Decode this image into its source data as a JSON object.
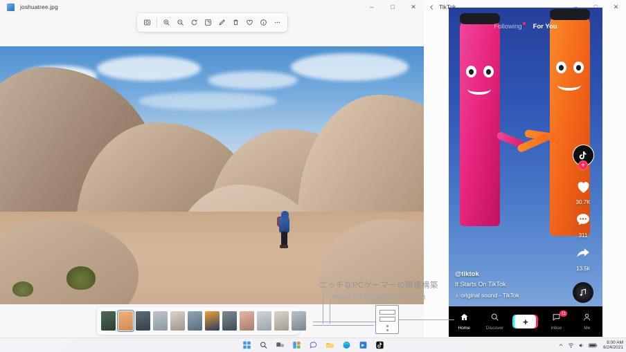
{
  "photos_window": {
    "title": "joshuatree.jpg",
    "icon": "photo-file-icon",
    "controls": {
      "minimize": "–",
      "maximize": "□",
      "close": "✕"
    },
    "toolbar": [
      {
        "name": "fit-to-window-icon",
        "label": "Fit to window"
      },
      {
        "name": "zoom-in-icon",
        "label": "Zoom in"
      },
      {
        "name": "zoom-out-icon",
        "label": "Zoom out"
      },
      {
        "name": "rotate-icon",
        "label": "Rotate"
      },
      {
        "name": "crop-icon",
        "label": "Crop"
      },
      {
        "name": "edit-pen-icon",
        "label": "Edit"
      },
      {
        "name": "delete-icon",
        "label": "Delete"
      },
      {
        "name": "favorite-heart-icon",
        "label": "Add to favorites"
      },
      {
        "name": "info-icon",
        "label": "File info"
      },
      {
        "name": "more-options-icon",
        "label": "See more"
      }
    ],
    "filmstrip": {
      "selected_index": 1,
      "thumbnails": [
        {
          "colors": [
            "#4e6b58",
            "#2e3d33"
          ]
        },
        {
          "colors": [
            "#f0b27a",
            "#d08a55"
          ]
        },
        {
          "colors": [
            "#5d6d79",
            "#333f49"
          ]
        },
        {
          "colors": [
            "#bfc6cd",
            "#8e979f"
          ]
        },
        {
          "colors": [
            "#d9d4cb",
            "#9b958b"
          ]
        },
        {
          "colors": [
            "#8fa4b2",
            "#5a6d7c"
          ]
        },
        {
          "colors": [
            "#f0a232",
            "#243a63"
          ]
        },
        {
          "colors": [
            "#7e8b95",
            "#3f4a54"
          ]
        },
        {
          "colors": [
            "#e3b5a6",
            "#a97b6d"
          ]
        },
        {
          "colors": [
            "#cfd6dc",
            "#9aa3ab"
          ]
        },
        {
          "colors": [
            "#dad4c9",
            "#a39c90"
          ]
        },
        {
          "colors": [
            "#b9c3cb",
            "#79848d"
          ]
        }
      ]
    }
  },
  "watermark": {
    "japanese": "ニッチなPCゲーマーの環境構築",
    "url": "www.nichepcgamer.com"
  },
  "tiktok_window": {
    "title": "TikTok",
    "back_icon": "back-arrow-icon",
    "controls": {
      "minimize": "–",
      "maximize": "□",
      "close": "✕"
    },
    "top_nav": {
      "following": "Following",
      "for_you": "For You",
      "active": "For You"
    },
    "actions": {
      "avatar_plus": "+",
      "like_count": "30.7K",
      "comment_count": "311",
      "share_count": "13.5k"
    },
    "caption": {
      "username": "@tiktok",
      "description": "It Starts On TikTok",
      "sound": "original sound - TikTok",
      "music_glyph": "♪"
    },
    "bottom_nav": [
      {
        "name": "home",
        "label": "Home",
        "icon": "home-icon",
        "active": true,
        "badge": ""
      },
      {
        "name": "discover",
        "label": "Discover",
        "icon": "search-icon",
        "active": false,
        "badge": ""
      },
      {
        "name": "create",
        "label": "",
        "icon": "plus-icon",
        "active": false,
        "badge": ""
      },
      {
        "name": "inbox",
        "label": "Inbox",
        "icon": "inbox-icon",
        "active": false,
        "badge": "11"
      },
      {
        "name": "me",
        "label": "Me",
        "icon": "person-icon",
        "active": false,
        "badge": ""
      }
    ]
  },
  "taskbar": {
    "items": [
      {
        "name": "start-button",
        "label": "Start"
      },
      {
        "name": "search-button",
        "label": "Search"
      },
      {
        "name": "task-view-button",
        "label": "Task View"
      },
      {
        "name": "widgets-button",
        "label": "Widgets"
      },
      {
        "name": "chat-button",
        "label": "Chat"
      },
      {
        "name": "file-explorer-button",
        "label": "File Explorer"
      },
      {
        "name": "edge-button",
        "label": "Microsoft Edge"
      },
      {
        "name": "store-button",
        "label": "Microsoft Store"
      },
      {
        "name": "tiktok-taskbar-button",
        "label": "TikTok"
      }
    ],
    "tray": {
      "chevron": "⌃",
      "network": "network-icon",
      "volume": "volume-icon",
      "battery": "battery-icon",
      "time": "8:00 AM",
      "date": "6/24/2021"
    }
  },
  "colors": {
    "tiktok_red": "#fe2c55",
    "tiktok_cyan": "#25f4ee",
    "accent_blue": "#4a7fc1"
  }
}
